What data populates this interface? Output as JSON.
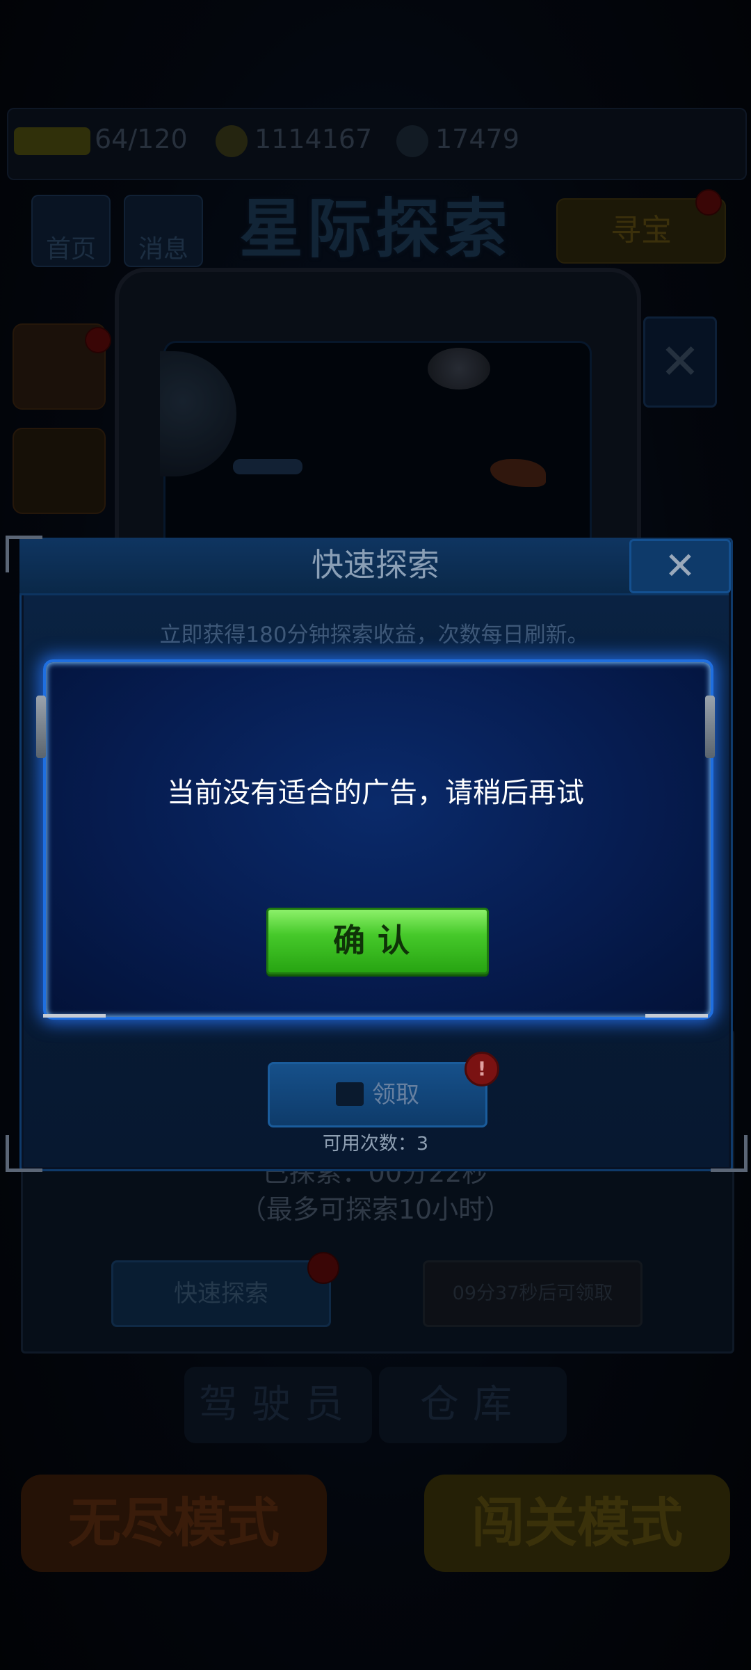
{
  "hud": {
    "energy": "64/120",
    "coins": "1114167",
    "gems": "17479"
  },
  "nav": {
    "home": "首页",
    "messages": "消息",
    "title": "星际探索",
    "treasure": "寻宝"
  },
  "quick_explore": {
    "title": "快速探索",
    "description": "立即获得180分钟探索收益，次数每日刷新。",
    "claim_label": "领取",
    "claim_badge": "!",
    "available_count": "可用次数：3"
  },
  "alert": {
    "message": "当前没有适合的广告，请稍后再试",
    "confirm_label": "确认"
  },
  "underlying": {
    "timer": "已探索：00分22秒",
    "max_hint": "（最多可探索10小时）",
    "quick_btn": "快速探索",
    "cooldown_btn": "09分37秒后可领取",
    "tab_pilot": "驾驶员",
    "tab_warehouse": "仓库",
    "mode_endless": "无尽模式",
    "mode_stage": "闯关模式"
  },
  "colors": {
    "accent_blue": "#1f6fe0",
    "confirm_green": "#46c92a",
    "badge_red": "#7a1212"
  }
}
